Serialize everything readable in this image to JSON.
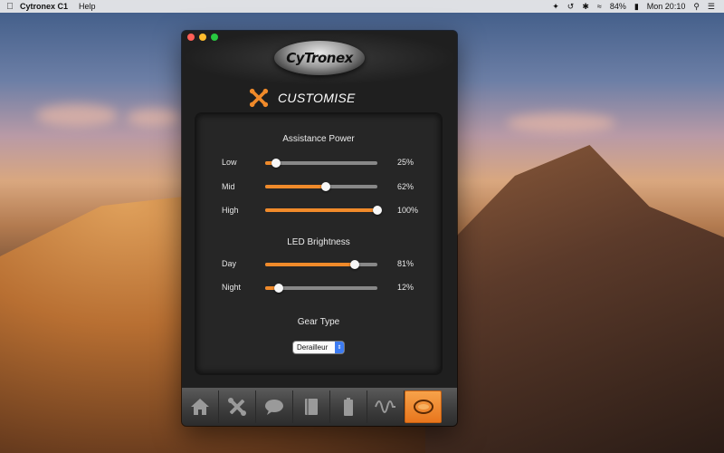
{
  "menubar": {
    "app_name": "Cytronex C1",
    "menus": [
      "Help"
    ],
    "battery": "84%",
    "clock": "Mon 20:10",
    "icons": [
      "apple-icon",
      "dropbox-icon",
      "time-machine-icon",
      "bluetooth-icon",
      "wifi-icon",
      "battery-icon",
      "search-icon",
      "control-center-icon"
    ]
  },
  "window": {
    "logo_text": "CyTronex",
    "header_title": "CUSTOMISE",
    "assistance": {
      "title": "Assistance Power",
      "rows": [
        {
          "label": "Low",
          "value": "25%",
          "level": 0.1
        },
        {
          "label": "Mid",
          "value": "62%",
          "level": 0.54
        },
        {
          "label": "High",
          "value": "100%",
          "level": 1.0
        }
      ]
    },
    "led": {
      "title": "LED Brightness",
      "rows": [
        {
          "label": "Day",
          "value": "81%",
          "level": 0.8
        },
        {
          "label": "Night",
          "value": "12%",
          "level": 0.12
        }
      ]
    },
    "gear": {
      "title": "Gear Type",
      "selected": "Derailleur"
    },
    "toolbar": [
      "home-icon",
      "tools-icon",
      "speech-bubble-icon",
      "book-icon",
      "battery-icon",
      "waveform-icon",
      "cytronex-logo-icon"
    ]
  },
  "colors": {
    "accent": "#f08a2a",
    "window_bg": "#1f1f1f"
  }
}
